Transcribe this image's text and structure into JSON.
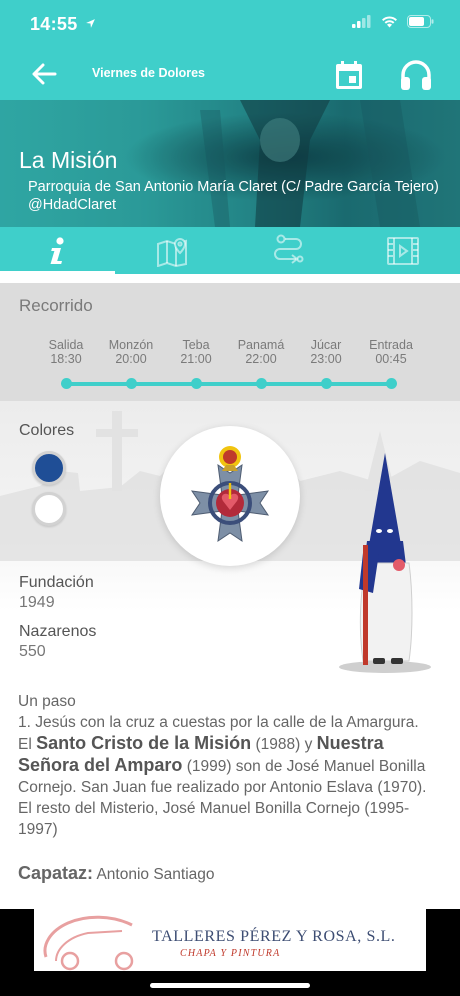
{
  "status": {
    "time": "14:55"
  },
  "nav": {
    "title": "Viernes de Dolores"
  },
  "hero": {
    "title": "La Misión",
    "subtitle": "Parroquia de San Antonio María Claret (C/ Padre García Tejero)",
    "handle": "@HdadClaret"
  },
  "tabs": [
    {
      "icon": "info-icon",
      "active": true
    },
    {
      "icon": "map-icon",
      "active": false
    },
    {
      "icon": "route-icon",
      "active": false
    },
    {
      "icon": "film-icon",
      "active": false
    }
  ],
  "route": {
    "title": "Recorrido",
    "stops": [
      {
        "name": "Salida",
        "time": "18:30"
      },
      {
        "name": "Monzón",
        "time": "20:00"
      },
      {
        "name": "Teba",
        "time": "21:00"
      },
      {
        "name": "Panamá",
        "time": "22:00"
      },
      {
        "name": "Júcar",
        "time": "23:00"
      },
      {
        "name": "Entrada",
        "time": "00:45"
      }
    ]
  },
  "info": {
    "colors_label": "Colores",
    "colors": [
      "#1f4e96",
      "#ffffff"
    ],
    "fundacion_label": "Fundación",
    "fundacion_value": "1949",
    "nazarenos_label": "Nazarenos",
    "nazarenos_value": "550",
    "pasos": "Un paso",
    "desc_1": "1. Jesús con la cruz a cuestas por la calle de la Amargura. El",
    "desc_b1": "Santo Cristo de la Misión",
    "desc_2": "(1988) y",
    "desc_b2": "Nuestra Señora del Amparo",
    "desc_3": "(1999) son de José Manuel Bonilla Cornejo. San Juan fue realizado por Antonio Eslava (1970). El resto del Misterio, José Manuel Bonilla Cornejo (1995-1997)",
    "capataz_label": "Capataz:",
    "capataz_value": "Antonio Santiago"
  },
  "ad": {
    "line1": "TALLERES PÉREZ Y ROSA, S.L.",
    "line2": "CHAPA Y PINTURA"
  },
  "theme": {
    "accent": "#3fcfca",
    "route_bg": "#dcdcdc"
  }
}
